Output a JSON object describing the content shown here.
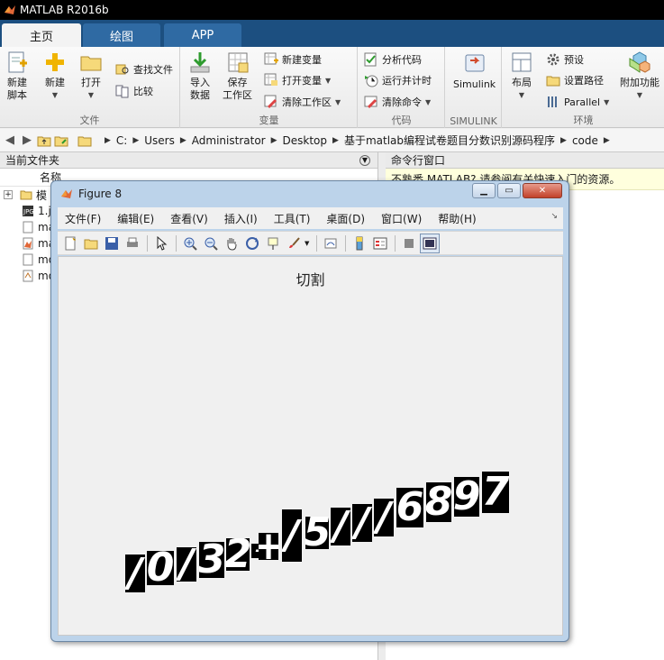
{
  "app": {
    "title": "MATLAB R2016b"
  },
  "tabs": [
    {
      "label": "主页"
    },
    {
      "label": "绘图"
    },
    {
      "label": "APP"
    }
  ],
  "ribbon": {
    "file": {
      "label": "文件",
      "new_script": "新建\n脚本",
      "new": "新建",
      "open": "打开",
      "find_files": "查找文件",
      "compare": "比较"
    },
    "variable": {
      "label": "变量",
      "import": "导入\n数据",
      "save": "保存\n工作区",
      "new_var": "新建变量",
      "open_var": "打开变量",
      "clear_ws": "清除工作区"
    },
    "code": {
      "label": "代码",
      "analyze": "分析代码",
      "run_time": "运行并计时",
      "clear_cmd": "清除命令"
    },
    "simulink": {
      "label": "SIMULINK",
      "btn": "Simulink"
    },
    "env": {
      "label": "环境",
      "layout": "布局",
      "prefs": "预设",
      "set_path": "设置路径",
      "parallel": "Parallel",
      "addons": "附加功能"
    }
  },
  "path": [
    "C:",
    "Users",
    "Administrator",
    "Desktop",
    "基于matlab编程试卷题目分数识别源码程序",
    "code"
  ],
  "left_panel": {
    "title": "当前文件夹",
    "name_header": "名称",
    "files": [
      "模",
      "1.j",
      "ma",
      "ma",
      "mo",
      "mo"
    ]
  },
  "right_panel": {
    "title": "命令行窗口",
    "notice": "不熟悉 MATLAB? 请参阅有关快速入门的资源。"
  },
  "figure": {
    "title": "Figure 8",
    "menu": [
      "文件(F)",
      "编辑(E)",
      "查看(V)",
      "插入(I)",
      "工具(T)",
      "桌面(D)",
      "窗口(W)",
      "帮助(H)"
    ],
    "plot_title": "切割",
    "segments": [
      "/",
      "0",
      "/",
      "3",
      "2",
      "-",
      "+",
      "/",
      "5",
      "/",
      "/",
      "/",
      "6",
      "8",
      "9",
      "7"
    ]
  },
  "colors": {
    "titlebar": "#000000",
    "tabstrip": "#1c4f80",
    "tab_inactive": "#2f6aa3",
    "notice_bg": "#ffffdd"
  }
}
